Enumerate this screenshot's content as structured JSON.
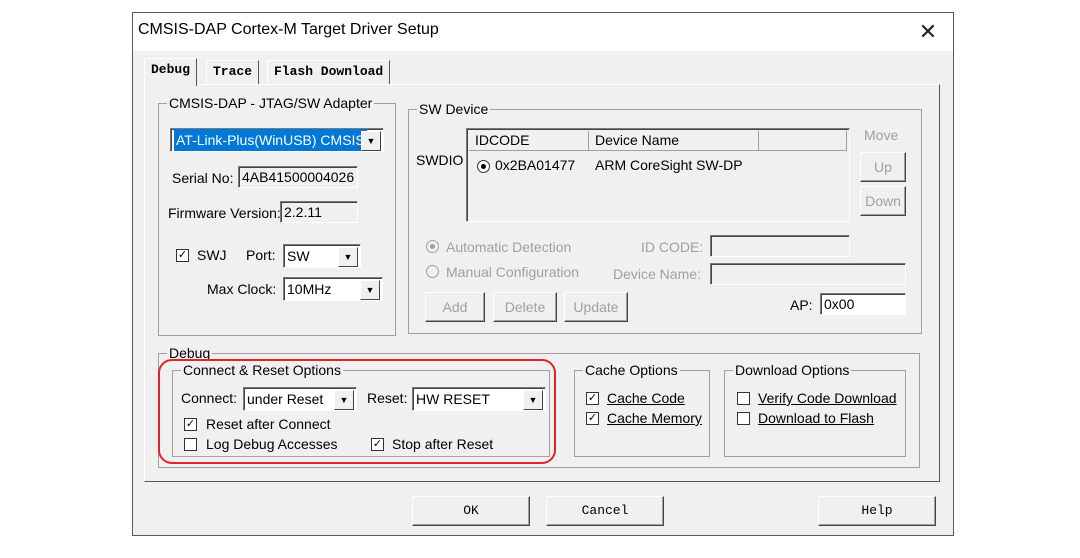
{
  "window": {
    "title": "CMSIS-DAP Cortex-M Target Driver Setup",
    "close_glyph": "✕"
  },
  "tabs": [
    {
      "label": "Debug",
      "active": true
    },
    {
      "label": "Trace",
      "active": false
    },
    {
      "label": "Flash Download",
      "active": false
    }
  ],
  "adapter": {
    "legend": "CMSIS-DAP - JTAG/SW Adapter",
    "selected": "AT-Link-Plus(WinUSB) CMSIS",
    "serial_label": "Serial No:",
    "serial_value": "4AB41500004026",
    "firmware_label": "Firmware Version:",
    "firmware_value": "2.2.11",
    "swj_label": "SWJ",
    "swj_checked": true,
    "port_label": "Port:",
    "port_value": "SW",
    "maxclock_label": "Max Clock:",
    "maxclock_value": "10MHz"
  },
  "sw_device": {
    "legend": "SW Device",
    "swdio_label": "SWDIO",
    "columns": [
      "IDCODE",
      "Device Name"
    ],
    "rows": [
      {
        "idcode": "0x2BA01477",
        "device": "ARM CoreSight SW-DP"
      }
    ],
    "move_label": "Move",
    "up_label": "Up",
    "down_label": "Down",
    "auto_detect_label": "Automatic Detection",
    "manual_config_label": "Manual Configuration",
    "idcode_label": "ID CODE:",
    "device_name_label": "Device Name:",
    "add_label": "Add",
    "delete_label": "Delete",
    "update_label": "Update",
    "ap_label": "AP:",
    "ap_value": "0x00"
  },
  "debug": {
    "legend": "Debug",
    "connect_reset": {
      "legend": "Connect & Reset Options",
      "connect_label": "Connect:",
      "connect_value": "under Reset",
      "reset_label": "Reset:",
      "reset_value": "HW RESET",
      "reset_after_connect_label": "Reset after Connect",
      "reset_after_connect_checked": true,
      "log_debug_label": "Log Debug Accesses",
      "log_debug_checked": false,
      "stop_after_reset_label": "Stop after Reset",
      "stop_after_reset_checked": true
    },
    "cache": {
      "legend": "Cache Options",
      "cache_code_label": "Cache Code",
      "cache_code_checked": true,
      "cache_memory_label": "Cache Memory",
      "cache_memory_checked": true
    },
    "download": {
      "legend": "Download Options",
      "verify_label": "Verify Code Download",
      "verify_checked": false,
      "download_flash_label": "Download to Flash",
      "download_flash_checked": false
    }
  },
  "buttons": {
    "ok": "OK",
    "cancel": "Cancel",
    "help": "Help"
  },
  "colors": {
    "highlight_ring": "#e0242c",
    "selection": "#0078d7",
    "dialog_bg": "#f0f0f0"
  }
}
